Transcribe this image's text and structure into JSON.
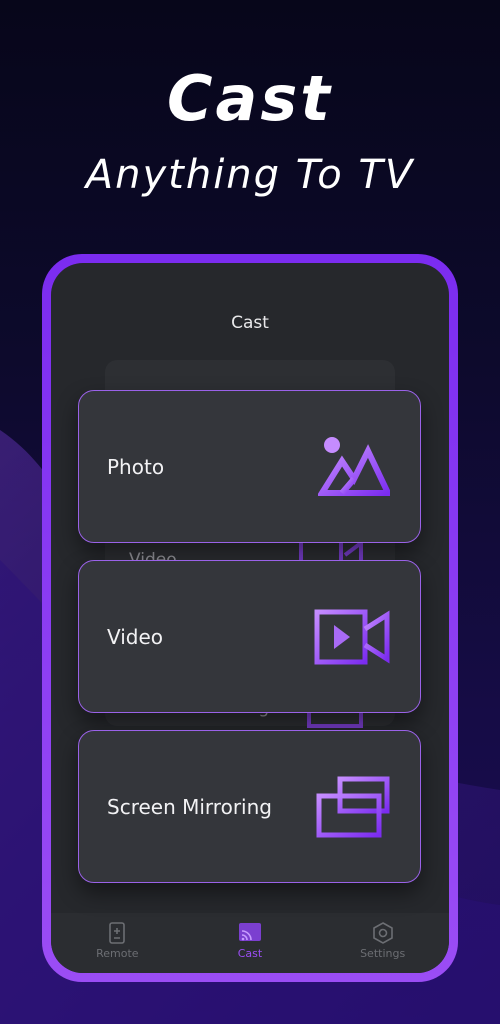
{
  "hero": {
    "title": "Cast",
    "subtitle": "Anything To TV"
  },
  "screen": {
    "title": "Cast",
    "ghost_items": [
      "Video",
      "Screen Mirroring"
    ]
  },
  "cards": [
    {
      "label": "Photo",
      "icon": "photo-icon"
    },
    {
      "label": "Video",
      "icon": "video-icon"
    },
    {
      "label": "Screen Mirroring",
      "icon": "screen-mirroring-icon"
    }
  ],
  "tabs": [
    {
      "label": "Remote",
      "icon": "remote-icon",
      "active": false
    },
    {
      "label": "Cast",
      "icon": "cast-icon",
      "active": true
    },
    {
      "label": "Settings",
      "icon": "settings-icon",
      "active": false
    }
  ],
  "colors": {
    "accent": "#9b4df5",
    "card_bg": "#34363b",
    "screen_bg": "#26282c"
  }
}
